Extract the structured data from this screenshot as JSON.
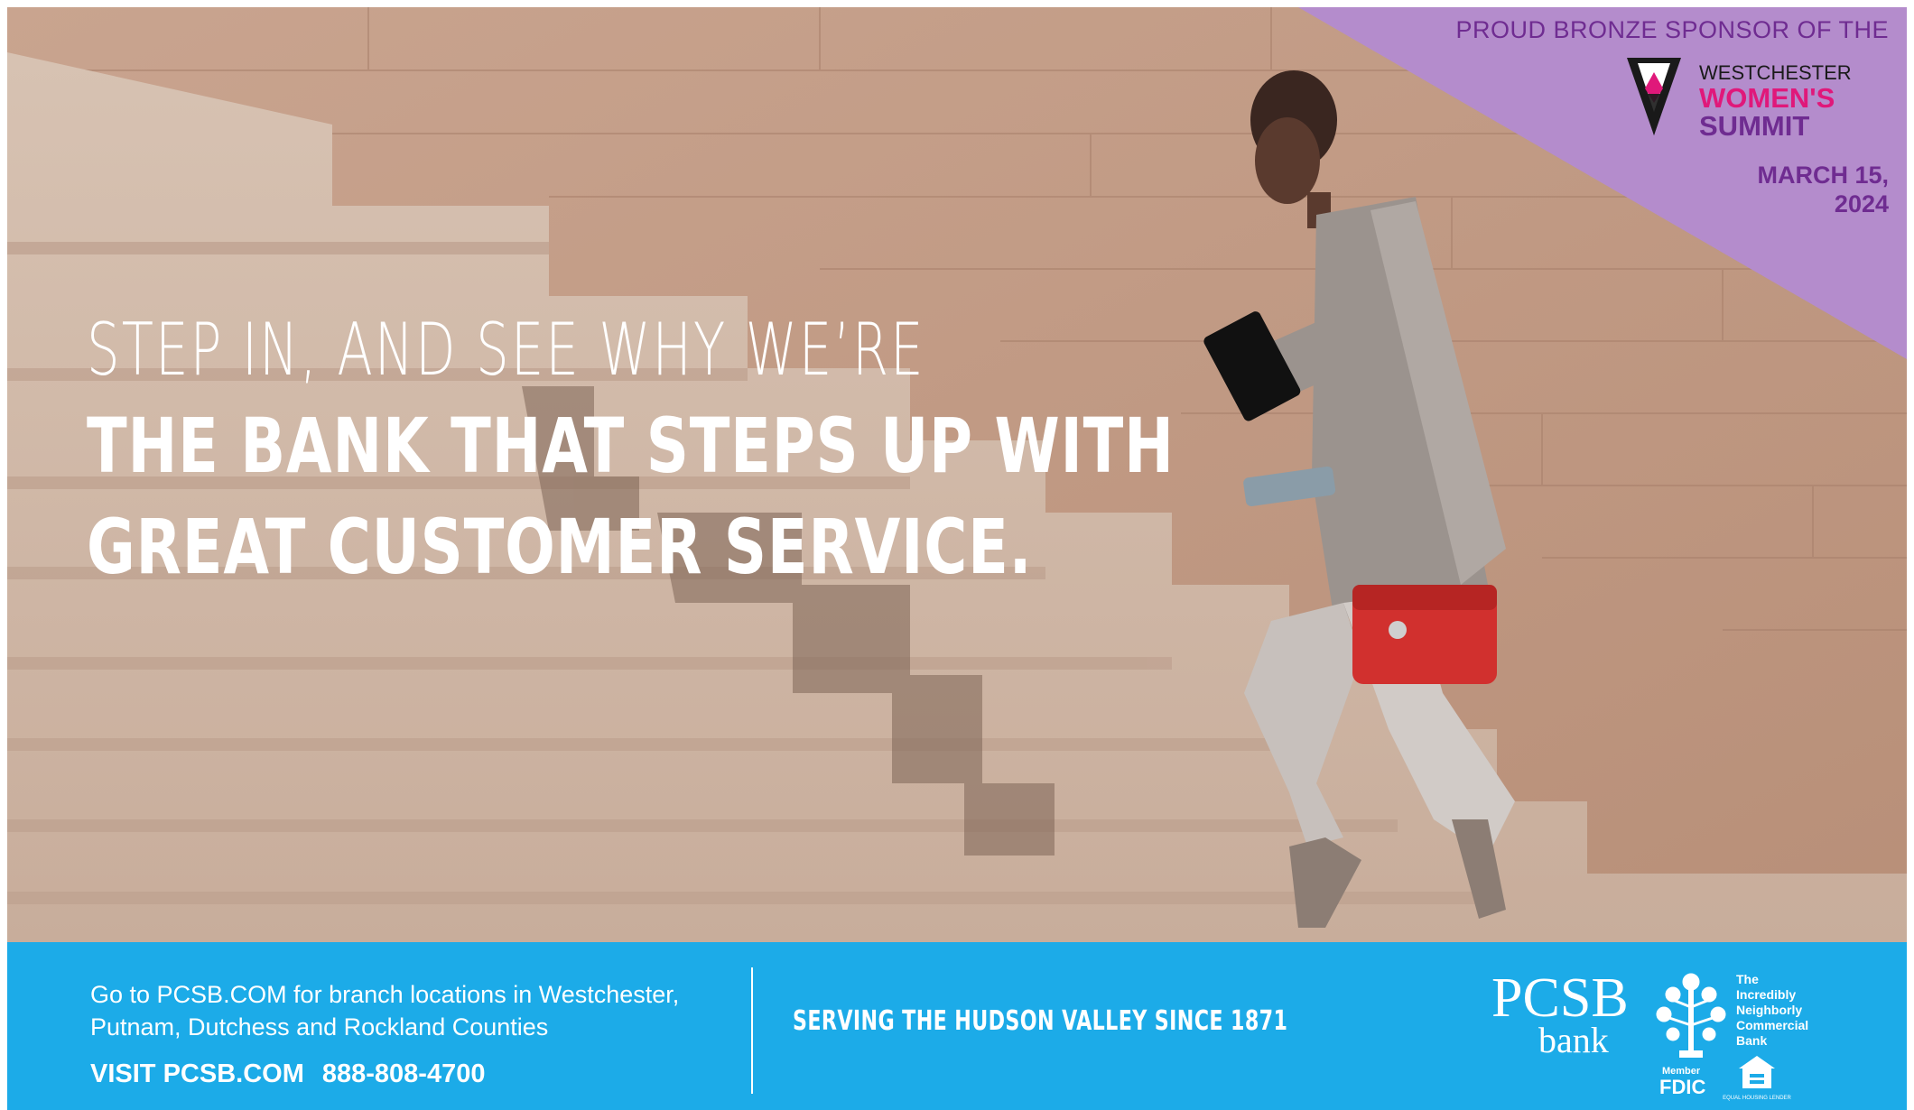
{
  "headline": {
    "line1": "STEP IN, AND SEE WHY WE’RE",
    "line2": "THE BANK THAT STEPS UP WITH",
    "line3": "GREAT CUSTOMER SERVICE."
  },
  "sponsor": {
    "label": "PROUD BRONZE SPONSOR OF THE",
    "event_top": "WESTCHESTER",
    "event_middle": "WOMEN'S",
    "event_bottom": "SUMMIT",
    "date_line1": "MARCH 15,",
    "date_line2": "2024"
  },
  "footer": {
    "address_line1": "Go to PCSB.COM for branch locations in Westchester,",
    "address_line2": "Putnam, Dutchess and Rockland Counties",
    "visit": "VISIT PCSB.COM",
    "phone": "888-808-4700",
    "tagline": "SERVING THE HUDSON VALLEY SINCE 1871",
    "brand_name": "PCSB",
    "brand_sub": "bank",
    "brand_slogan": [
      "The",
      "Incredibly",
      "Neighborly",
      "Commercial",
      "Bank"
    ],
    "fdic_member": "Member",
    "fdic": "FDIC",
    "lender": "EQUAL HOUSING LENDER"
  },
  "colors": {
    "footer_blue": "#1cabe8",
    "sponsor_purple": "#b48ccc",
    "purple_text": "#6f2c91",
    "magenta": "#e0187a",
    "bag_red": "#d1302e"
  }
}
